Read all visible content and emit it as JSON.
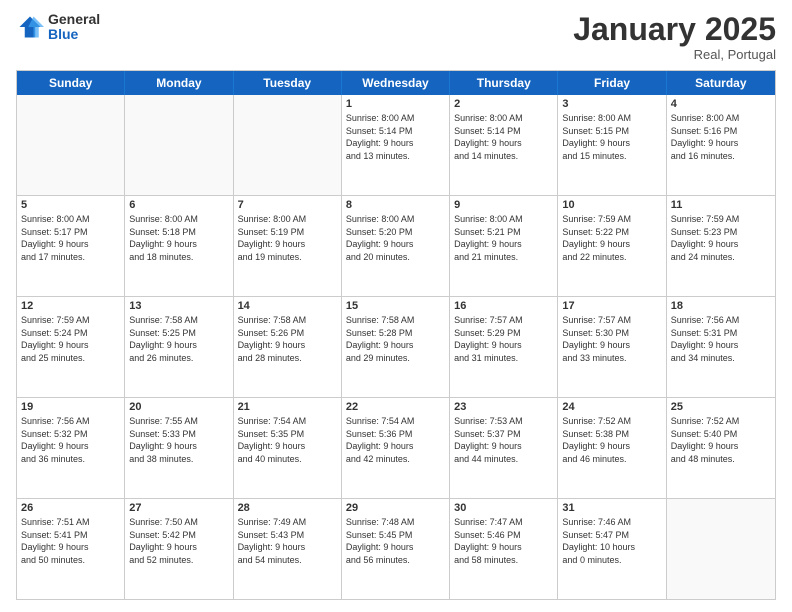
{
  "logo": {
    "general": "General",
    "blue": "Blue"
  },
  "title": "January 2025",
  "location": "Real, Portugal",
  "header_days": [
    "Sunday",
    "Monday",
    "Tuesday",
    "Wednesday",
    "Thursday",
    "Friday",
    "Saturday"
  ],
  "weeks": [
    [
      {
        "day": "",
        "info": ""
      },
      {
        "day": "",
        "info": ""
      },
      {
        "day": "",
        "info": ""
      },
      {
        "day": "1",
        "info": "Sunrise: 8:00 AM\nSunset: 5:14 PM\nDaylight: 9 hours\nand 13 minutes."
      },
      {
        "day": "2",
        "info": "Sunrise: 8:00 AM\nSunset: 5:14 PM\nDaylight: 9 hours\nand 14 minutes."
      },
      {
        "day": "3",
        "info": "Sunrise: 8:00 AM\nSunset: 5:15 PM\nDaylight: 9 hours\nand 15 minutes."
      },
      {
        "day": "4",
        "info": "Sunrise: 8:00 AM\nSunset: 5:16 PM\nDaylight: 9 hours\nand 16 minutes."
      }
    ],
    [
      {
        "day": "5",
        "info": "Sunrise: 8:00 AM\nSunset: 5:17 PM\nDaylight: 9 hours\nand 17 minutes."
      },
      {
        "day": "6",
        "info": "Sunrise: 8:00 AM\nSunset: 5:18 PM\nDaylight: 9 hours\nand 18 minutes."
      },
      {
        "day": "7",
        "info": "Sunrise: 8:00 AM\nSunset: 5:19 PM\nDaylight: 9 hours\nand 19 minutes."
      },
      {
        "day": "8",
        "info": "Sunrise: 8:00 AM\nSunset: 5:20 PM\nDaylight: 9 hours\nand 20 minutes."
      },
      {
        "day": "9",
        "info": "Sunrise: 8:00 AM\nSunset: 5:21 PM\nDaylight: 9 hours\nand 21 minutes."
      },
      {
        "day": "10",
        "info": "Sunrise: 7:59 AM\nSunset: 5:22 PM\nDaylight: 9 hours\nand 22 minutes."
      },
      {
        "day": "11",
        "info": "Sunrise: 7:59 AM\nSunset: 5:23 PM\nDaylight: 9 hours\nand 24 minutes."
      }
    ],
    [
      {
        "day": "12",
        "info": "Sunrise: 7:59 AM\nSunset: 5:24 PM\nDaylight: 9 hours\nand 25 minutes."
      },
      {
        "day": "13",
        "info": "Sunrise: 7:58 AM\nSunset: 5:25 PM\nDaylight: 9 hours\nand 26 minutes."
      },
      {
        "day": "14",
        "info": "Sunrise: 7:58 AM\nSunset: 5:26 PM\nDaylight: 9 hours\nand 28 minutes."
      },
      {
        "day": "15",
        "info": "Sunrise: 7:58 AM\nSunset: 5:28 PM\nDaylight: 9 hours\nand 29 minutes."
      },
      {
        "day": "16",
        "info": "Sunrise: 7:57 AM\nSunset: 5:29 PM\nDaylight: 9 hours\nand 31 minutes."
      },
      {
        "day": "17",
        "info": "Sunrise: 7:57 AM\nSunset: 5:30 PM\nDaylight: 9 hours\nand 33 minutes."
      },
      {
        "day": "18",
        "info": "Sunrise: 7:56 AM\nSunset: 5:31 PM\nDaylight: 9 hours\nand 34 minutes."
      }
    ],
    [
      {
        "day": "19",
        "info": "Sunrise: 7:56 AM\nSunset: 5:32 PM\nDaylight: 9 hours\nand 36 minutes."
      },
      {
        "day": "20",
        "info": "Sunrise: 7:55 AM\nSunset: 5:33 PM\nDaylight: 9 hours\nand 38 minutes."
      },
      {
        "day": "21",
        "info": "Sunrise: 7:54 AM\nSunset: 5:35 PM\nDaylight: 9 hours\nand 40 minutes."
      },
      {
        "day": "22",
        "info": "Sunrise: 7:54 AM\nSunset: 5:36 PM\nDaylight: 9 hours\nand 42 minutes."
      },
      {
        "day": "23",
        "info": "Sunrise: 7:53 AM\nSunset: 5:37 PM\nDaylight: 9 hours\nand 44 minutes."
      },
      {
        "day": "24",
        "info": "Sunrise: 7:52 AM\nSunset: 5:38 PM\nDaylight: 9 hours\nand 46 minutes."
      },
      {
        "day": "25",
        "info": "Sunrise: 7:52 AM\nSunset: 5:40 PM\nDaylight: 9 hours\nand 48 minutes."
      }
    ],
    [
      {
        "day": "26",
        "info": "Sunrise: 7:51 AM\nSunset: 5:41 PM\nDaylight: 9 hours\nand 50 minutes."
      },
      {
        "day": "27",
        "info": "Sunrise: 7:50 AM\nSunset: 5:42 PM\nDaylight: 9 hours\nand 52 minutes."
      },
      {
        "day": "28",
        "info": "Sunrise: 7:49 AM\nSunset: 5:43 PM\nDaylight: 9 hours\nand 54 minutes."
      },
      {
        "day": "29",
        "info": "Sunrise: 7:48 AM\nSunset: 5:45 PM\nDaylight: 9 hours\nand 56 minutes."
      },
      {
        "day": "30",
        "info": "Sunrise: 7:47 AM\nSunset: 5:46 PM\nDaylight: 9 hours\nand 58 minutes."
      },
      {
        "day": "31",
        "info": "Sunrise: 7:46 AM\nSunset: 5:47 PM\nDaylight: 10 hours\nand 0 minutes."
      },
      {
        "day": "",
        "info": ""
      }
    ]
  ]
}
